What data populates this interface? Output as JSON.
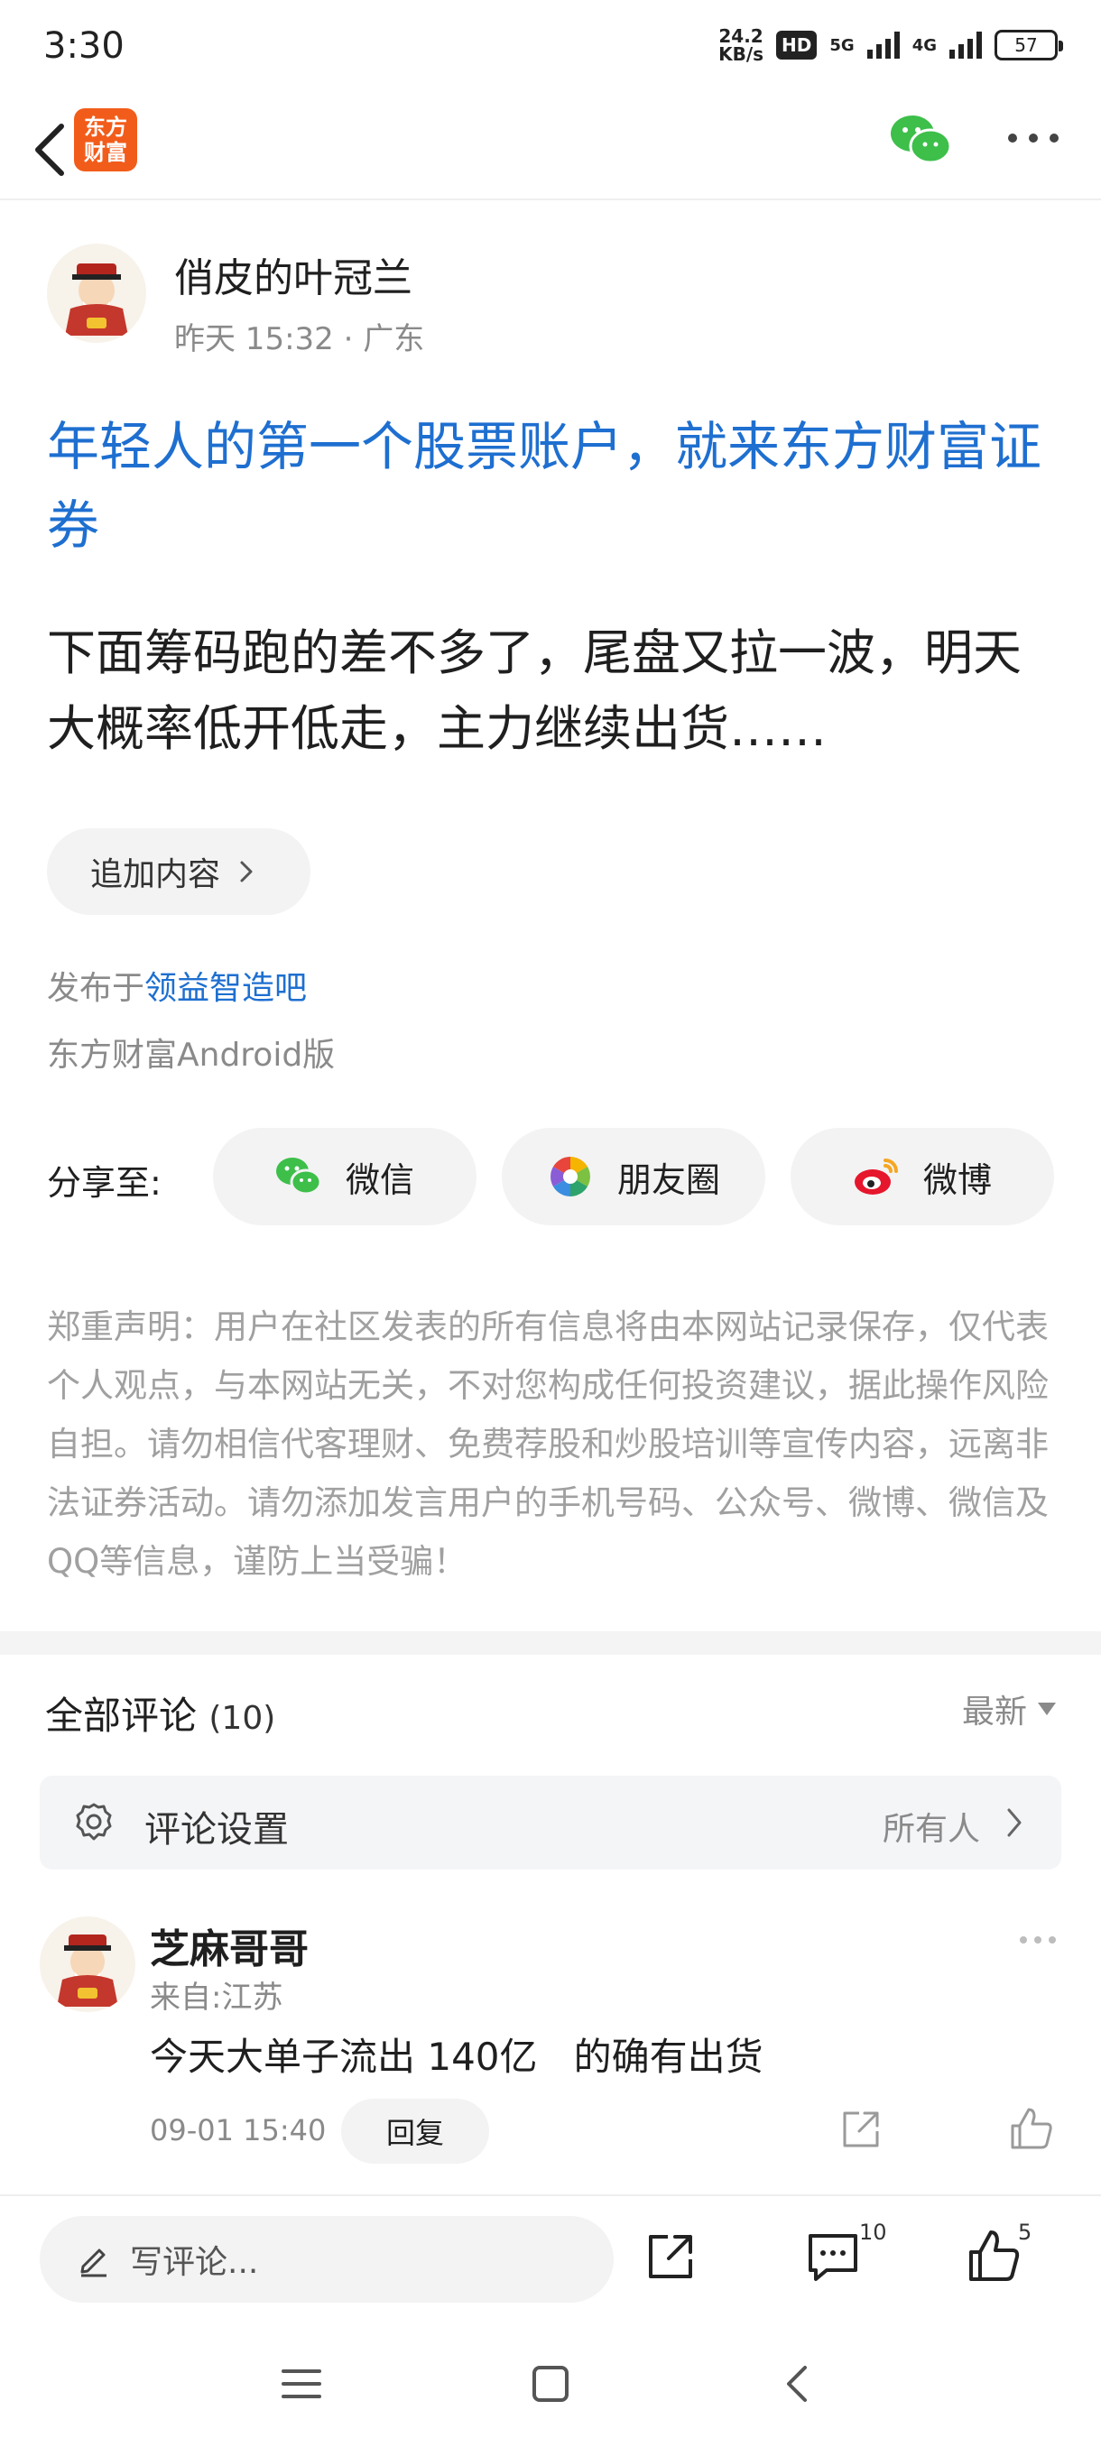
{
  "status_bar": {
    "time": "3:30",
    "net_speed_value": "24.2",
    "net_speed_unit": "KB/s",
    "hd": "HD",
    "sim1": "5G",
    "sim2": "4G",
    "battery": "57"
  },
  "nav": {
    "logo_text_line1": "东方",
    "logo_text_line2": "财富",
    "brand_color": "#f25c1a"
  },
  "post": {
    "author": "俏皮的叶冠兰",
    "meta": "昨天 15:32 · 广东",
    "title": "年轻人的第一个股票账户，就来东方财富证券",
    "body": "下面筹码跑的差不多了，尾盘又拉一波，明天大概率低开低走，主力继续出货……",
    "append_label": "追加内容",
    "published_prefix": "发布于",
    "forum": "领益智造吧",
    "client": "东方财富Android版",
    "title_color": "#1e6fd0"
  },
  "share": {
    "label": "分享至:",
    "wechat": "微信",
    "moments": "朋友圈",
    "weibo": "微博"
  },
  "disclaimer": "郑重声明：用户在社区发表的所有信息将由本网站记录保存，仅代表个人观点，与本网站无关，不对您构成任何投资建议，据此操作风险自担。请勿相信代客理财、免费荐股和炒股培训等宣传内容，远离非法证券活动。请勿添加发言用户的手机号码、公众号、微博、微信及QQ等信息，谨防上当受骗！",
  "comments": {
    "title": "全部评论",
    "count": "(10)",
    "sort": "最新",
    "settings_label": "评论设置",
    "settings_value": "所有人",
    "items": [
      {
        "name": "芝麻哥哥",
        "location": "来自:江苏",
        "text": "今天大单子流出 140亿   的确有出货",
        "time": "09-01 15:40",
        "reply_label": "回复"
      }
    ]
  },
  "bottom_bar": {
    "write_placeholder": "写评论...",
    "comment_count": "10",
    "like_count": "5"
  }
}
